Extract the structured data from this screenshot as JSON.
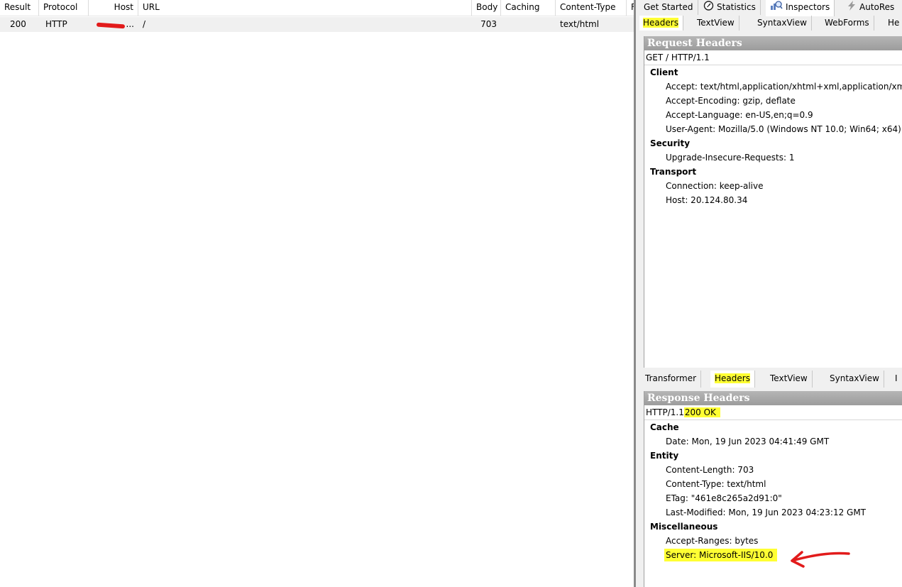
{
  "sessions": {
    "columns": [
      "Result",
      "Protocol",
      "Host",
      "URL",
      "Body",
      "Caching",
      "Content-Type",
      "F"
    ],
    "row": {
      "result": "200",
      "protocol": "HTTP",
      "host": "...",
      "url": "/",
      "body": "703",
      "caching": "",
      "content_type": "text/html"
    }
  },
  "top_tabs": {
    "get_started": "Get Started",
    "statistics": "Statistics",
    "inspectors": "Inspectors",
    "autoresponder": "AutoRes"
  },
  "request_tabs": {
    "headers": "Headers",
    "textview": "TextView",
    "syntaxview": "SyntaxView",
    "webforms": "WebForms",
    "hex": "He"
  },
  "request": {
    "title": "Request Headers",
    "status_line": "GET / HTTP/1.1",
    "groups": [
      {
        "name": "Client",
        "headers": [
          "Accept: text/html,application/xhtml+xml,application/xml",
          "Accept-Encoding: gzip, deflate",
          "Accept-Language: en-US,en;q=0.9",
          "User-Agent: Mozilla/5.0 (Windows NT 10.0; Win64; x64)"
        ]
      },
      {
        "name": "Security",
        "headers": [
          "Upgrade-Insecure-Requests: 1"
        ]
      },
      {
        "name": "Transport",
        "headers": [
          "Connection: keep-alive",
          "Host: 20.124.80.34"
        ]
      }
    ]
  },
  "response_tabs": {
    "transformer": "Transformer",
    "headers": "Headers",
    "textview": "TextView",
    "syntaxview": "SyntaxView",
    "more": "I"
  },
  "response": {
    "title": "Response Headers",
    "status_version": "HTTP/1.1",
    "status_code": "200 OK",
    "groups": [
      {
        "name": "Cache",
        "headers": [
          "Date: Mon, 19 Jun 2023 04:41:49 GMT"
        ]
      },
      {
        "name": "Entity",
        "headers": [
          "Content-Length: 703",
          "Content-Type: text/html",
          "ETag: \"461e8c265a2d91:0\"",
          "Last-Modified: Mon, 19 Jun 2023 04:23:12 GMT"
        ]
      },
      {
        "name": "Miscellaneous",
        "headers": [
          "Accept-Ranges: bytes",
          "Server: Microsoft-IIS/10.0"
        ]
      }
    ]
  },
  "colors": {
    "highlight": "#ffff33",
    "annotation": "#e21b1b",
    "section_header": "#a8a8a8"
  }
}
